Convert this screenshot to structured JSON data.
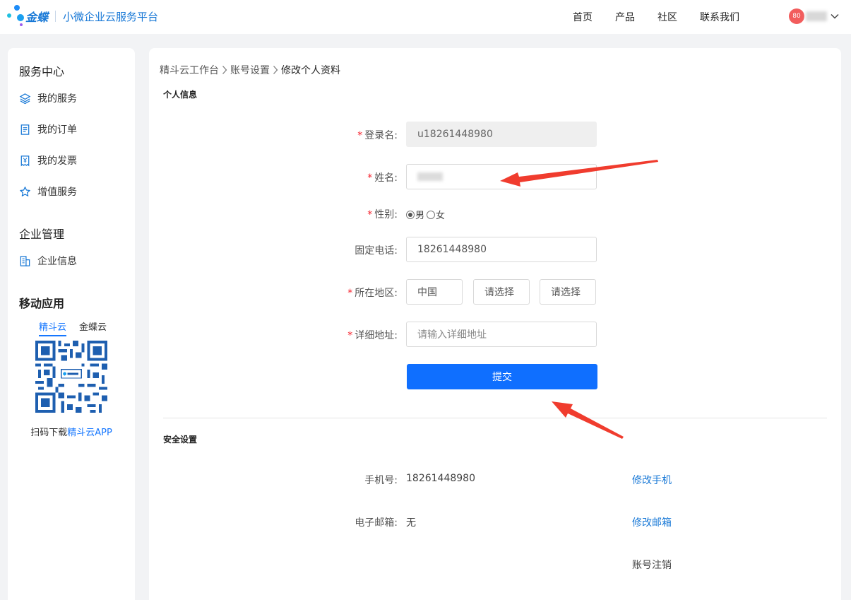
{
  "header": {
    "brand": "金蝶",
    "subtitle": "小微企业云服务平台",
    "nav": [
      "首页",
      "产品",
      "社区",
      "联系我们"
    ],
    "avatar_text": "80"
  },
  "sidebar": {
    "service_title": "服务中心",
    "service_items": [
      "我的服务",
      "我的订单",
      "我的发票",
      "增值服务"
    ],
    "enterprise_title": "企业管理",
    "enterprise_items": [
      "企业信息"
    ],
    "mobile_title": "移动应用",
    "mobile_tabs": [
      "精斗云",
      "金蝶云"
    ],
    "scan_prefix": "扫码下载",
    "scan_app": "精斗云APP"
  },
  "main": {
    "breadcrumb": [
      "精斗云工作台",
      "账号设置",
      "修改个人资料"
    ],
    "personal_title": "个人信息",
    "login_label": "登录名:",
    "login_value": "u18261448980",
    "name_label": "姓名:",
    "gender_label": "性别:",
    "gender_male": "男",
    "gender_female": "女",
    "phone_label": "固定电话:",
    "phone_value": "18261448980",
    "region_label": "所在地区:",
    "region_country": "中国",
    "region_province": "请选择",
    "region_city": "请选择",
    "address_label": "详细地址:",
    "address_placeholder": "请输入详细地址",
    "submit_label": "提交",
    "security_title": "安全设置",
    "mobile_label": "手机号:",
    "mobile_value": "18261448980",
    "change_mobile": "修改手机",
    "email_label": "电子邮箱:",
    "email_value": "无",
    "change_email": "修改邮箱",
    "cancel_account": "账号注销"
  },
  "colors": {
    "primary": "#0f6fff",
    "link": "#1677d6",
    "required": "#f5222d",
    "annotation_arrow": "#f03c2e"
  }
}
